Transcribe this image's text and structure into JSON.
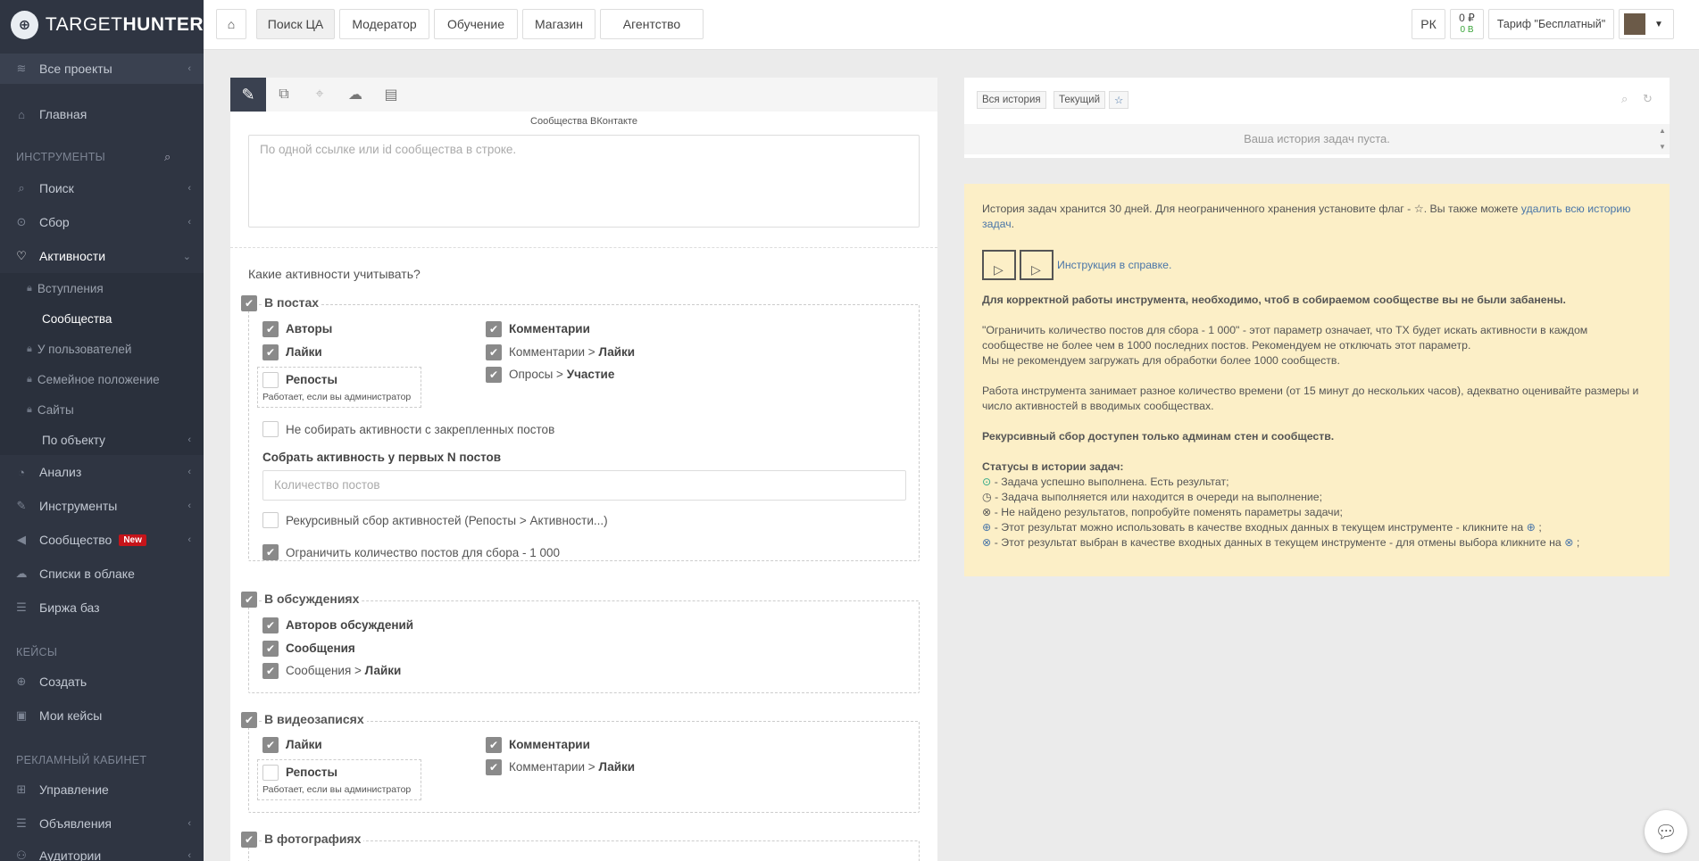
{
  "app": {
    "logo_target": "TARGET",
    "logo_hunter": "HUNTER"
  },
  "sidebar": {
    "all_projects": "Все проекты",
    "home": "Главная",
    "tools_section": "ИНСТРУМЕНТЫ",
    "search": "Поиск",
    "collect": "Сбор",
    "activity": "Активности",
    "sub_joins": "Вступления",
    "sub_communities": "Сообщества",
    "sub_users": "У пользователей",
    "sub_family": "Семейное положение",
    "sub_sites": "Сайты",
    "sub_by_object": "По объекту",
    "analysis": "Анализ",
    "instruments": "Инструменты",
    "community": "Сообщество",
    "community_badge": "New",
    "cloud_lists": "Списки в облаке",
    "base_exchange": "Биржа баз",
    "cases_section": "КЕЙСЫ",
    "create": "Создать",
    "my_cases": "Мои кейсы",
    "ads_section": "РЕКЛАМНЫЙ КАБИНЕТ",
    "manage": "Управление",
    "ads": "Объявления",
    "audiences": "Аудитории"
  },
  "topbar": {
    "home_icon": "home-icon",
    "tabs": [
      "Поиск ЦА",
      "Модератор",
      "Обучение",
      "Магазин",
      "Агентство"
    ],
    "rk": "РК",
    "balance_rub": "0 ₽",
    "balance_b": "0 В",
    "tariff": "Тариф \"Бесплатный\""
  },
  "form": {
    "communities_label": "Сообщества ВКонтакте",
    "communities_placeholder": "По одной ссылке или id сообщества в строке.",
    "which_activities": "Какие активности учитывать?",
    "posts": {
      "title": "В постах",
      "authors": "Авторы",
      "likes": "Лайки",
      "reposts": "Репосты",
      "reposts_note": "Работает, если вы администратор",
      "comments": "Комментарии",
      "comments_prefix": "Комментарии >",
      "comments_likes": "Лайки",
      "polls_prefix": "Опросы >",
      "polls_part": "Участие",
      "no_pinned": "Не собирать активности с закрепленных постов",
      "first_n_label": "Собрать активность у первых N постов",
      "first_n_placeholder": "Количество постов",
      "recursive": "Рекурсивный сбор активностей (Репосты > Активности...)",
      "limit": "Ограничить количество постов для сбора - 1 000"
    },
    "discussions": {
      "title": "В обсуждениях",
      "authors": "Авторов обсуждений",
      "messages": "Сообщения",
      "messages_prefix": "Сообщения >",
      "messages_likes": "Лайки"
    },
    "videos": {
      "title": "В видеозаписях",
      "likes": "Лайки",
      "reposts": "Репосты",
      "reposts_note": "Работает, если вы администратор",
      "comments": "Комментарии",
      "comments_prefix": "Комментарии >",
      "comments_likes": "Лайки"
    },
    "photos": {
      "title": "В фотографиях"
    }
  },
  "history": {
    "all": "Вся история",
    "current": "Текущий",
    "empty": "Ваша история задач пуста."
  },
  "info": {
    "p1a": "История задач хранится 30 дней. Для неограниченного хранения установите флаг - ☆. Вы также можете ",
    "p1link": "удалить всю историю задач",
    "p1end": ".",
    "manual_link": "Инструкция в справке.",
    "warning": "Для корректной работы инструмента, необходимо, чтоб в собираемом сообществе вы не были забанены.",
    "limit1": "\"Ограничить количество постов для сбора - 1 000\" - этот параметр означает, что ТХ будет искать активности в каждом сообществе не более чем в 1000 последних постов. Рекомендуем не отключать этот параметр.",
    "limit2": "Мы не рекомендуем загружать для обработки более 1000 сообществ.",
    "time": "Работа инструмента занимает разное количество времени (от 15 минут до нескольких часов), адекватно оценивайте размеры и число активностей в вводимых сообществах.",
    "recursive": "Рекурсивный сбор доступен только админам стен и сообществ.",
    "statuses_title": "Статусы в истории задач:",
    "s1": "- Задача успешно выполнена. Есть результат;",
    "s2": "- Задача выполняется или находится в очереди на выполнение;",
    "s3": "- Не найдено результатов, попробуйте поменять параметры задачи;",
    "s4": "- Этот результат можно использовать в качестве входных данных в текущем инструменте - кликните на",
    "s5": "- Этот результат выбран в качестве входных данных в текущем инструменте - для отмены выбора кликните на",
    "semicolon": ";"
  }
}
